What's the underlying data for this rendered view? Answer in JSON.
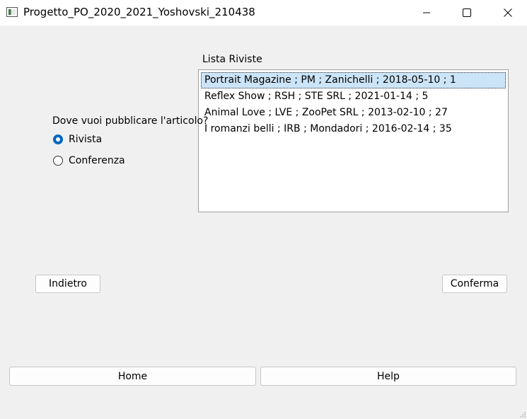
{
  "window": {
    "title": "Progetto_PO_2020_2021_Yoshovski_210438"
  },
  "list": {
    "heading": "Lista Riviste",
    "items": [
      "Portrait Magazine ; PM ; Zanichelli ; 2018-05-10 ; 1",
      "Reflex Show ; RSH ; STE SRL ; 2021-01-14 ; 5",
      "Animal Love ; LVE ; ZooPet SRL ; 2013-02-10 ; 27",
      "I romanzi belli ; IRB ; Mondadori ; 2016-02-14 ; 35"
    ],
    "selected_index": 0
  },
  "publish": {
    "question": "Dove vuoi pubblicare l'articolo?",
    "options": [
      "Rivista",
      "Conferenza"
    ],
    "selected": "Rivista"
  },
  "buttons": {
    "back": "Indietro",
    "confirm": "Conferma",
    "home": "Home",
    "help": "Help"
  },
  "colors": {
    "accent": "#0067c0",
    "selection": "#cce4f7"
  }
}
